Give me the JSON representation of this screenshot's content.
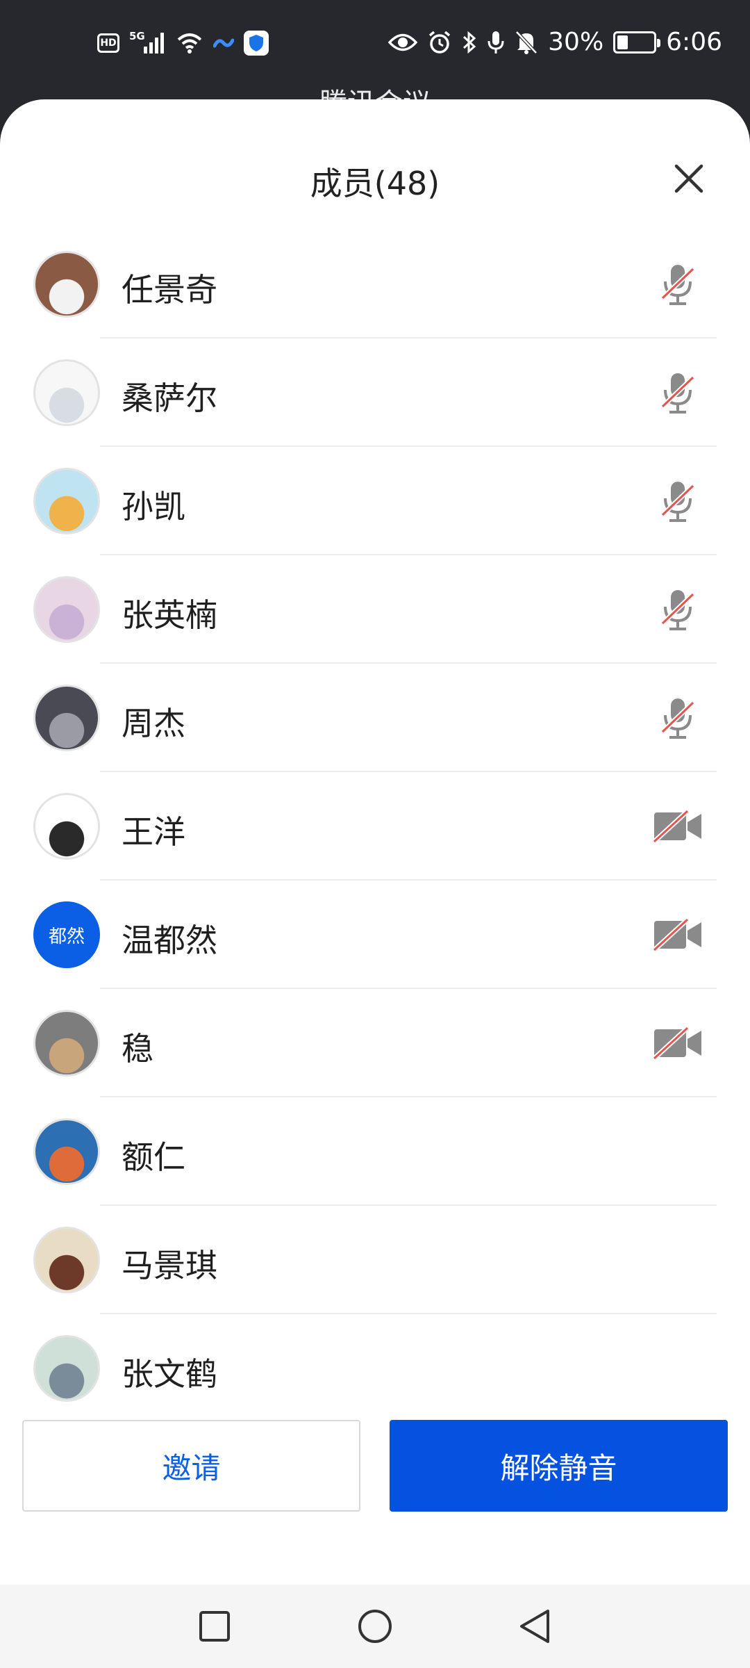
{
  "status_bar": {
    "hd_label": "HD",
    "network_label": "5G",
    "battery_text": "30%",
    "battery_level": 0.3,
    "time": "6:06",
    "icons": [
      "hd-icon",
      "signal-5g-icon",
      "wifi-icon",
      "app-logo-icon",
      "shield-icon",
      "eye-icon",
      "alarm-icon",
      "bluetooth-icon",
      "mic-icon",
      "mute-bell-icon",
      "battery-icon"
    ]
  },
  "behind": {
    "app_title": "腾讯会议"
  },
  "sheet": {
    "title": "成员(48)",
    "close_icon": "close-icon"
  },
  "members": [
    {
      "name": "任景奇",
      "avatar": "photo",
      "status": "mic-muted"
    },
    {
      "name": "桑萨尔",
      "avatar": "photo",
      "status": "mic-muted"
    },
    {
      "name": "孙凯",
      "avatar": "photo",
      "status": "mic-muted"
    },
    {
      "name": "张英楠",
      "avatar": "photo",
      "status": "mic-muted"
    },
    {
      "name": "周杰",
      "avatar": "photo",
      "status": "mic-muted"
    },
    {
      "name": "王洋",
      "avatar": "photo",
      "status": "camera-off"
    },
    {
      "name": "温都然",
      "avatar": "text",
      "avatar_text": "都然",
      "status": "camera-off"
    },
    {
      "name": "稳",
      "avatar": "photo",
      "status": "camera-off"
    },
    {
      "name": "额仁",
      "avatar": "photo",
      "status": "none"
    },
    {
      "name": "马景琪",
      "avatar": "photo",
      "status": "none"
    },
    {
      "name": "张文鹤",
      "avatar": "photo",
      "status": "none"
    }
  ],
  "actions": {
    "invite_label": "邀请",
    "unmute_label": "解除静音"
  },
  "colors": {
    "accent": "#0552e0",
    "muted_slash": "#e4554f",
    "icon_gray": "#8a8a8a"
  },
  "nav": {
    "icons": [
      "recent-apps-icon",
      "home-icon",
      "back-icon"
    ]
  }
}
